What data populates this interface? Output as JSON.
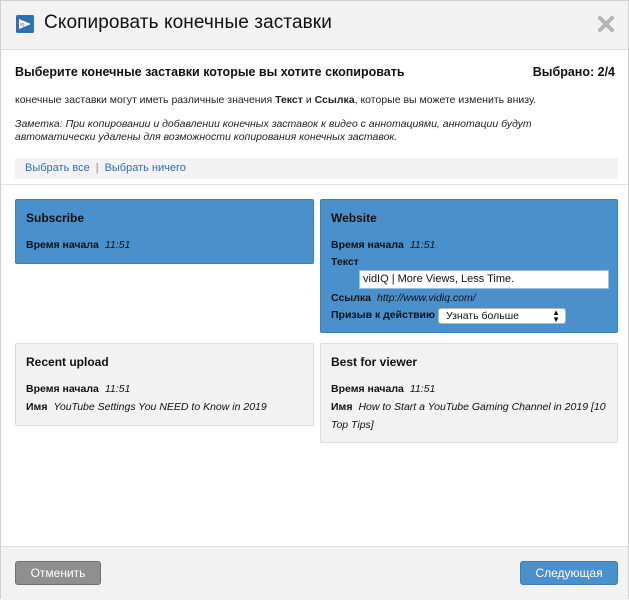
{
  "dialog": {
    "title": "Скопировать конечные заставки",
    "close_icon": "close-x-icon",
    "logo_icon": "vidiq-logo-icon"
  },
  "subhead": {
    "prompt": "Выберите конечные заставки которые вы хотите скопировать",
    "selected_count": "Выбрано: 2/4"
  },
  "info": {
    "part1": "конечные заставки могут иметь различные значения ",
    "bold1": "Текст",
    "part2": " и ",
    "bold2": "Ссылка",
    "part3": ", которые вы можете изменить внизу."
  },
  "note": "Заметка: При копировании и добавлении конечных заставок к видео с аннотациями, аннотации будут автоматически удалены для возможности копирования конечных заставок.",
  "select_links": {
    "select_all": "Выбрать все",
    "separator": "|",
    "select_none": "Выбрать ничего"
  },
  "cards": [
    {
      "title": "Subscribe",
      "selected": true,
      "start_label": "Время начала",
      "start_value": "11:51"
    },
    {
      "title": "Website",
      "selected": true,
      "start_label": "Время начала",
      "start_value": "11:51",
      "text_label": "Текст",
      "text_value": "vidIQ | More Views, Less Time.",
      "link_label": "Ссылка",
      "link_value": "http://www.vidiq.com/",
      "cta_label": "Призыв к действию",
      "cta_value": "Узнать больше"
    },
    {
      "title": "Recent upload",
      "selected": false,
      "start_label": "Время начала",
      "start_value": "11:51",
      "name_label": "Имя",
      "name_value": "YouTube Settings You NEED to Know in 2019"
    },
    {
      "title": "Best for viewer",
      "selected": false,
      "start_label": "Время начала",
      "start_value": "11:51",
      "name_label": "Имя",
      "name_value_line1": "How to Start a YouTube Gaming Channel in 2019 [10",
      "name_value_line2": "Top Tips]"
    }
  ],
  "footer": {
    "cancel": "Отменить",
    "next": "Следующая"
  },
  "colors": {
    "selected_card": "#4a90cc",
    "unselected_card": "#f2f2f2",
    "link": "#2f6fb3",
    "cancel_button": "#8f8f8f"
  }
}
